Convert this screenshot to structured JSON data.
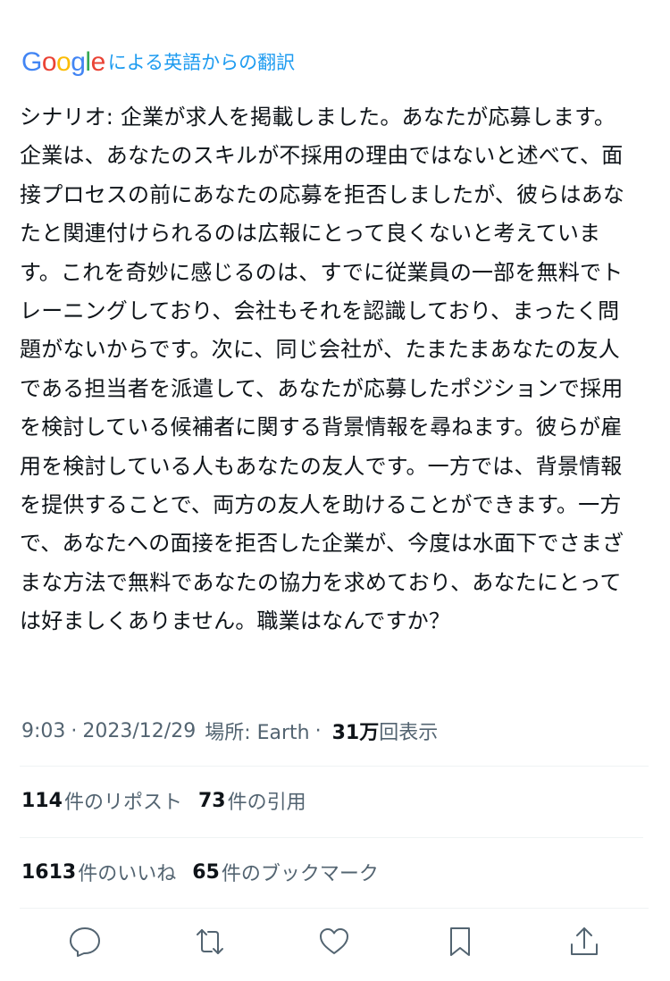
{
  "translation": {
    "google_logo_letters": [
      {
        "ch": "G",
        "color": "#4285F4"
      },
      {
        "ch": "o",
        "color": "#EA4335"
      },
      {
        "ch": "o",
        "color": "#FBBC05"
      },
      {
        "ch": "g",
        "color": "#4285F4"
      },
      {
        "ch": "l",
        "color": "#34A853"
      },
      {
        "ch": "e",
        "color": "#EA4335"
      }
    ],
    "label": "による英語からの翻訳"
  },
  "tweet": {
    "text": "シナリオ: 企業が求人を掲載しました。あなたが応募します。企業は、あなたのスキルが不採用の理由ではないと述べて、面接プロセスの前にあなたの応募を拒否しましたが、彼らはあなたと関連付けられるのは広報にとって良くないと考えています。これを奇妙に感じるのは、すでに従業員の一部を無料でトレーニングしており、会社もそれを認識しており、まったく問題がないからです。次に、同じ会社が、たまたまあなたの友人である担当者を派遣して、あなたが応募したポジションで採用を検討している候補者に関する背景情報を尋ねます。彼らが雇用を検討している人もあなたの友人です。一方では、背景情報を提供することで、両方の友人を助けることができます。一方で、あなたへの面接を拒否した企業が、今度は水面下でさまざまな方法で無料であなたの協力を求めており、あなたにとっては好ましくありません。職業はなんですか？"
  },
  "meta": {
    "time": "9:03",
    "separator": "·",
    "date": "2023/12/29",
    "location": "場所: Earth",
    "views_count": "31万",
    "views_label": "回表示"
  },
  "stats_row1": [
    {
      "count": "114",
      "label": "件のリポスト"
    },
    {
      "count": "73",
      "label": "件の引用"
    }
  ],
  "stats_row2": [
    {
      "count": "1613",
      "label": "件のいいね"
    },
    {
      "count": "65",
      "label": "件のブックマーク"
    }
  ],
  "actions": [
    "reply-icon",
    "repost-icon",
    "like-icon",
    "bookmark-icon",
    "share-icon"
  ],
  "colors": {
    "text_primary": "#0f1419",
    "text_secondary": "#536471",
    "accent": "#1d9bf0",
    "divider": "#eff3f4"
  }
}
